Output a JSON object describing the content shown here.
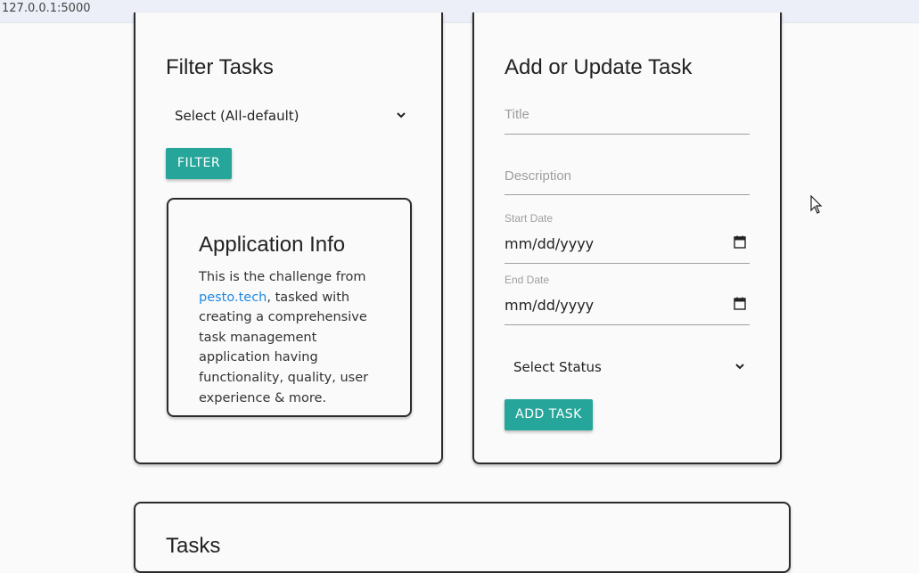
{
  "browser": {
    "url": "127.0.0.1:5000"
  },
  "filter": {
    "title": "Filter Tasks",
    "select_value": "Select (All-default)",
    "button_label": "FILTER"
  },
  "info": {
    "title": "Application Info",
    "text_before": "This is the challenge from ",
    "link_text": "pesto.tech",
    "text_after": ", tasked with creating a comprehensive task management application having functionality, quality, user experience & more."
  },
  "task_form": {
    "title": "Add or Update Task",
    "title_placeholder": "Title",
    "description_placeholder": "Description",
    "start_label": "Start Date",
    "start_value": "mm/dd/yyyy",
    "end_label": "End Date",
    "end_value": "mm/dd/yyyy",
    "status_value": "Select Status",
    "button_label": "ADD TASK"
  },
  "tasks": {
    "title": "Tasks"
  },
  "colors": {
    "accent": "#26a69a",
    "link": "#1e88e5"
  }
}
